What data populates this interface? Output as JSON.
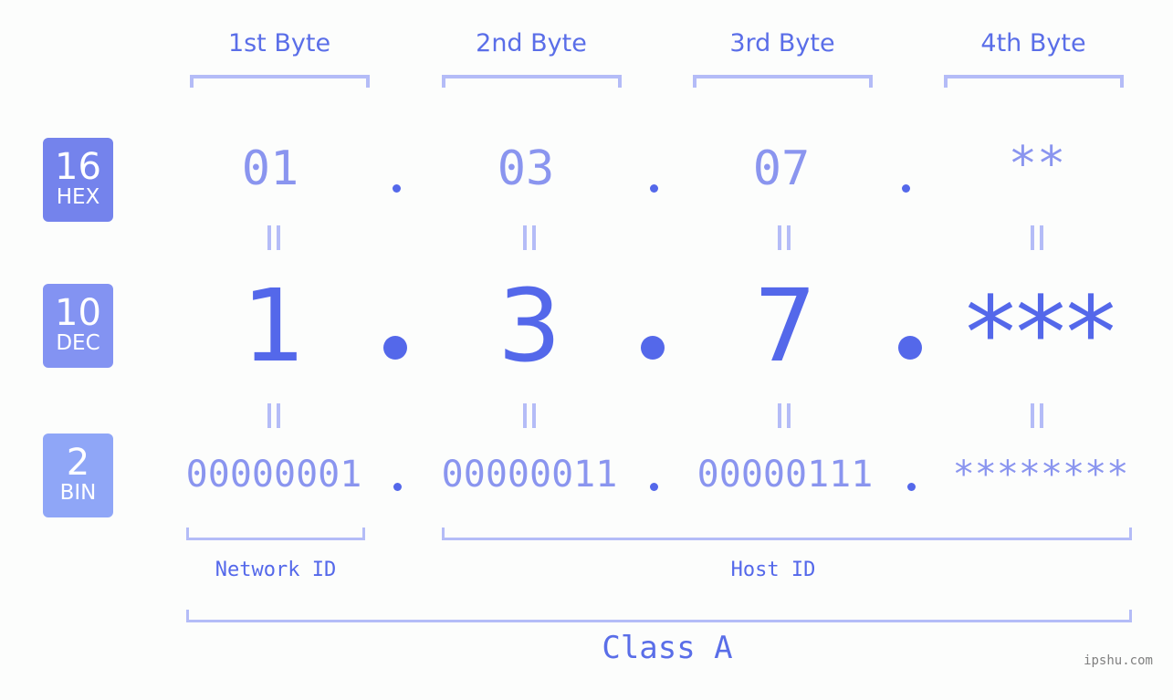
{
  "bytes": [
    {
      "header": "1st Byte",
      "hex": "01",
      "dec": "1",
      "bin": "00000001"
    },
    {
      "header": "2nd Byte",
      "hex": "03",
      "dec": "3",
      "bin": "00000011"
    },
    {
      "header": "3rd Byte",
      "hex": "07",
      "dec": "7",
      "bin": "00000111"
    },
    {
      "header": "4th Byte",
      "hex": "**",
      "dec": "***",
      "bin": "********"
    }
  ],
  "badges": {
    "hex": {
      "base": "16",
      "label": "HEX",
      "color": "#7483ec"
    },
    "dec": {
      "base": "10",
      "label": "DEC",
      "color": "#8393f2"
    },
    "bin": {
      "base": "2",
      "label": "BIN",
      "color": "#8fa6f7"
    }
  },
  "segments": {
    "network": "Network ID",
    "host": "Host ID"
  },
  "ip_class": "Class A",
  "watermark": "ipshu.com",
  "colors": {
    "accent": "#5468ea",
    "light_value": "#8a95ef",
    "bracket": "#b4bcf7",
    "background": "#fcfdfc"
  }
}
